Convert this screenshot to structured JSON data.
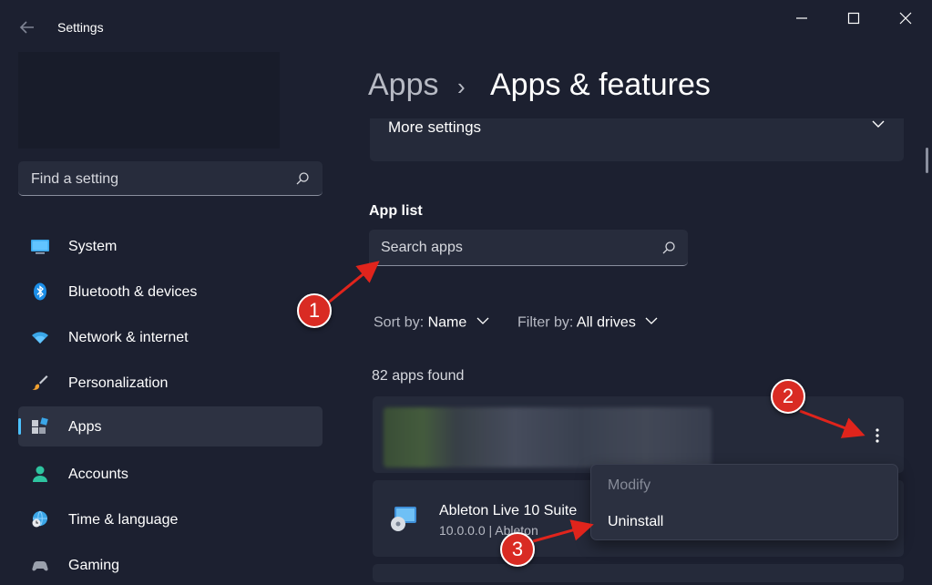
{
  "window": {
    "title": "Settings",
    "back_icon": "back-arrow-icon",
    "minimize_glyph": "—",
    "maximize_glyph": "☐",
    "close_glyph": "✕"
  },
  "sidebar": {
    "search_placeholder": "Find a setting",
    "items": [
      {
        "label": "System",
        "icon": "monitor-icon",
        "selected": false
      },
      {
        "label": "Bluetooth & devices",
        "icon": "bluetooth-icon",
        "selected": false
      },
      {
        "label": "Network & internet",
        "icon": "wifi-icon",
        "selected": false
      },
      {
        "label": "Personalization",
        "icon": "brush-icon",
        "selected": false
      },
      {
        "label": "Apps",
        "icon": "apps-icon",
        "selected": true
      },
      {
        "label": "Accounts",
        "icon": "person-icon",
        "selected": false
      },
      {
        "label": "Time & language",
        "icon": "globe-clock-icon",
        "selected": false
      },
      {
        "label": "Gaming",
        "icon": "gamepad-icon",
        "selected": false
      }
    ]
  },
  "header": {
    "breadcrumb_parent": "Apps",
    "breadcrumb_separator": "›",
    "breadcrumb_current": "Apps & features"
  },
  "main": {
    "more_settings_label": "More settings",
    "app_list_heading": "App list",
    "search_placeholder": "Search apps",
    "sort_label": "Sort by:",
    "sort_value": "Name",
    "filter_label": "Filter by:",
    "filter_value": "All drives",
    "count_text": "82 apps found",
    "apps": [
      {
        "name": "",
        "version": "",
        "blurred": true
      },
      {
        "name": "Ableton Live 10 Suite",
        "version": "10.0.0.0  |  Ableton"
      }
    ]
  },
  "context_menu": {
    "items": [
      {
        "label": "Modify",
        "enabled": false
      },
      {
        "label": "Uninstall",
        "enabled": true
      }
    ]
  },
  "callouts": [
    "1",
    "2",
    "3"
  ],
  "colors": {
    "background": "#1c2030",
    "card": "#252a3a",
    "accent": "#4cc2ff",
    "callout": "#d92b23"
  }
}
